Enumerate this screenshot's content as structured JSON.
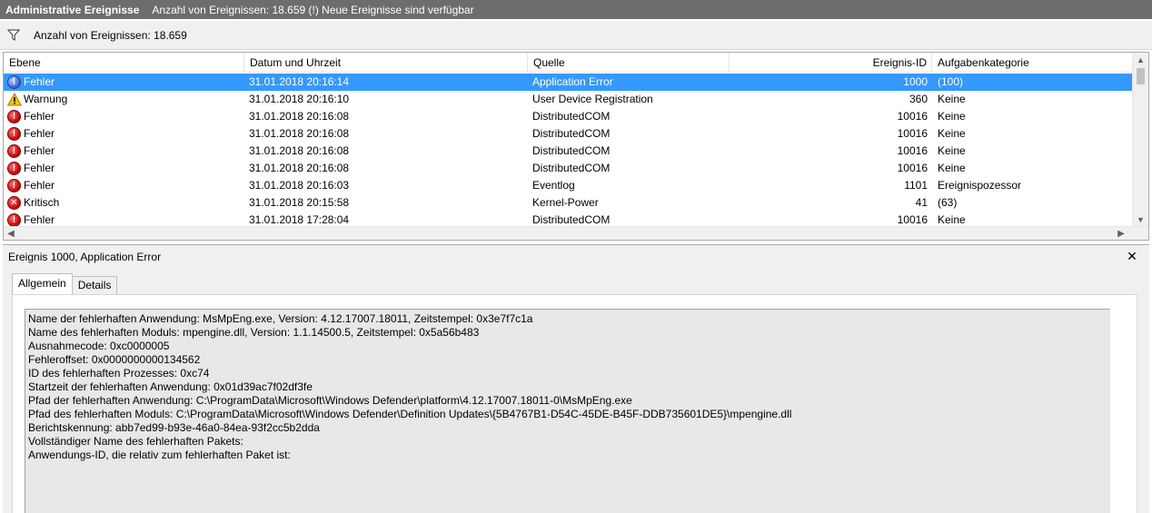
{
  "title": {
    "main": "Administrative Ereignisse",
    "subtitle": "Anzahl von Ereignissen: 18.659 (!) Neue Ereignisse sind verfügbar"
  },
  "filter": {
    "icon": "filter-icon",
    "count_label": "Anzahl von Ereignissen: 18.659"
  },
  "columns": {
    "ebene": "Ebene",
    "datum": "Datum und Uhrzeit",
    "quelle": "Quelle",
    "id": "Ereignis-ID",
    "kategorie": "Aufgabenkategorie"
  },
  "rows": [
    {
      "level": "Fehler",
      "icon": "info",
      "date": "31.01.2018 20:16:14",
      "source": "Application Error",
      "id": "1000",
      "category": "(100)",
      "selected": true
    },
    {
      "level": "Warnung",
      "icon": "warn",
      "date": "31.01.2018 20:16:10",
      "source": "User Device Registration",
      "id": "360",
      "category": "Keine"
    },
    {
      "level": "Fehler",
      "icon": "err",
      "date": "31.01.2018 20:16:08",
      "source": "DistributedCOM",
      "id": "10016",
      "category": "Keine"
    },
    {
      "level": "Fehler",
      "icon": "err",
      "date": "31.01.2018 20:16:08",
      "source": "DistributedCOM",
      "id": "10016",
      "category": "Keine"
    },
    {
      "level": "Fehler",
      "icon": "err",
      "date": "31.01.2018 20:16:08",
      "source": "DistributedCOM",
      "id": "10016",
      "category": "Keine"
    },
    {
      "level": "Fehler",
      "icon": "err",
      "date": "31.01.2018 20:16:08",
      "source": "DistributedCOM",
      "id": "10016",
      "category": "Keine"
    },
    {
      "level": "Fehler",
      "icon": "err",
      "date": "31.01.2018 20:16:03",
      "source": "Eventlog",
      "id": "1101",
      "category": "Ereignispozessor"
    },
    {
      "level": "Kritisch",
      "icon": "crit",
      "date": "31.01.2018 20:15:58",
      "source": "Kernel-Power",
      "id": "41",
      "category": "(63)"
    },
    {
      "level": "Fehler",
      "icon": "err",
      "date": "31.01.2018 17:28:04",
      "source": "DistributedCOM",
      "id": "10016",
      "category": "Keine"
    }
  ],
  "details": {
    "header": "Ereignis 1000, Application Error",
    "tabs": [
      "Allgemein",
      "Details"
    ],
    "lines": [
      "Name der fehlerhaften Anwendung: MsMpEng.exe, Version: 4.12.17007.18011, Zeitstempel: 0x3e7f7c1a",
      "Name des fehlerhaften Moduls: mpengine.dll, Version: 1.1.14500.5, Zeitstempel: 0x5a56b483",
      "Ausnahmecode: 0xc0000005",
      "Fehleroffset: 0x0000000000134562",
      "ID des fehlerhaften Prozesses: 0xc74",
      "Startzeit der fehlerhaften Anwendung: 0x01d39ac7f02df3fe",
      "Pfad der fehlerhaften Anwendung: C:\\ProgramData\\Microsoft\\Windows Defender\\platform\\4.12.17007.18011-0\\MsMpEng.exe",
      "Pfad des fehlerhaften Moduls: C:\\ProgramData\\Microsoft\\Windows Defender\\Definition Updates\\{5B4767B1-D54C-45DE-B45F-DDB735601DE5}\\mpengine.dll",
      "Berichtskennung: abb7ed99-b93e-46a0-84ea-93f2cc5b2dda",
      "Vollständiger Name des fehlerhaften Pakets:",
      "Anwendungs-ID, die relativ zum fehlerhaften Paket ist:"
    ]
  },
  "colors": {
    "titlebar": "#6d6d6d",
    "selection": "#3399ff",
    "error": "#c00000",
    "warning": "#f5c400",
    "info": "#3a5bd1"
  }
}
